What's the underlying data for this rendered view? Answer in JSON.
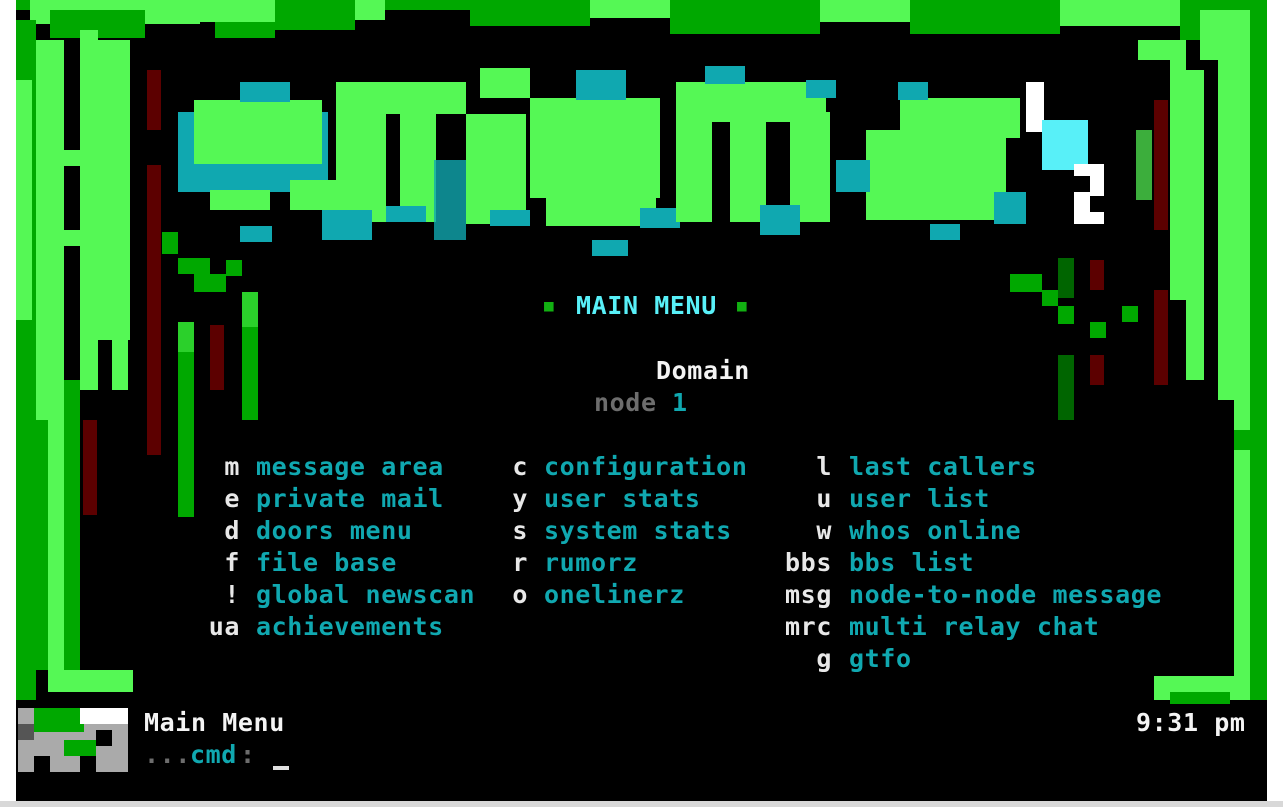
{
  "colors": {
    "background": "#000000",
    "bright_green": "#55f855",
    "dark_green": "#00a800",
    "teal": "#10a8b0",
    "bright_cyan": "#58f0f8",
    "dark_red": "#a80000",
    "white": "#ffffff",
    "grey": "#6d6d6d"
  },
  "logo": {
    "version_mark": "½"
  },
  "header": {
    "bullet_left": "■",
    "title": "MAIN MENU",
    "bullet_right": "■",
    "system_name": "Domain",
    "node_label": "node",
    "node_number": "1"
  },
  "menu": {
    "col1": [
      {
        "key": "m",
        "label": "message area"
      },
      {
        "key": "e",
        "label": "private mail"
      },
      {
        "key": "d",
        "label": "doors menu"
      },
      {
        "key": "f",
        "label": "file base"
      },
      {
        "key": "!",
        "label": "global newscan"
      },
      {
        "key": "ua",
        "label": "achievements"
      }
    ],
    "col2": [
      {
        "key": "c",
        "label": "configuration"
      },
      {
        "key": "y",
        "label": "user stats"
      },
      {
        "key": "s",
        "label": "system stats"
      },
      {
        "key": "r",
        "label": "rumorz"
      },
      {
        "key": "o",
        "label": "onelinerz"
      }
    ],
    "col3": [
      {
        "key": "l",
        "label": "last callers"
      },
      {
        "key": "u",
        "label": "user list"
      },
      {
        "key": "w",
        "label": "whos online"
      },
      {
        "key": "bbs",
        "label": "bbs list"
      },
      {
        "key": "msg",
        "label": "node-to-node message"
      },
      {
        "key": "mrc",
        "label": "multi relay chat"
      },
      {
        "key": "g",
        "label": "gtfo"
      }
    ]
  },
  "status": {
    "location": "Main Menu",
    "time": "9:31 pm"
  },
  "prompt": {
    "dots": "...",
    "label": "cmd",
    "colon": ":"
  }
}
